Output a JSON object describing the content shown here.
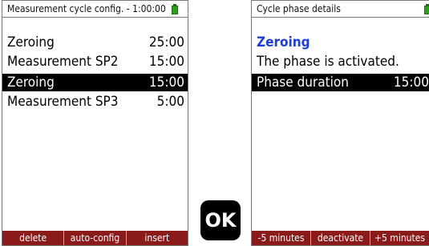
{
  "left_screen": {
    "title": "Measurement cycle config. - 1:00:00",
    "rows": [
      {
        "label": "Zeroing",
        "value": "25:00"
      },
      {
        "label": "Measurement SP2",
        "value": "15:00"
      },
      {
        "label": "Zeroing",
        "value": "15:00"
      },
      {
        "label": "Measurement SP3",
        "value": "5:00"
      }
    ],
    "softkeys": [
      "delete",
      "auto-config",
      "insert"
    ]
  },
  "ok_key": {
    "label": "OK"
  },
  "right_screen": {
    "title": "Cycle phase details",
    "phase_name": "Zeroing",
    "status_text": "The phase is activated.",
    "duration_label": "Phase duration",
    "duration_value": "15:00",
    "softkeys": [
      "-5 minutes",
      "deactivate",
      "+5 minutes"
    ]
  },
  "colors": {
    "softkey_bar": "#8b1a1a",
    "heading": "#1f3fd0",
    "battery": "#2f9e1f",
    "selection": "#000000"
  },
  "icons": {
    "battery": "battery-icon"
  }
}
